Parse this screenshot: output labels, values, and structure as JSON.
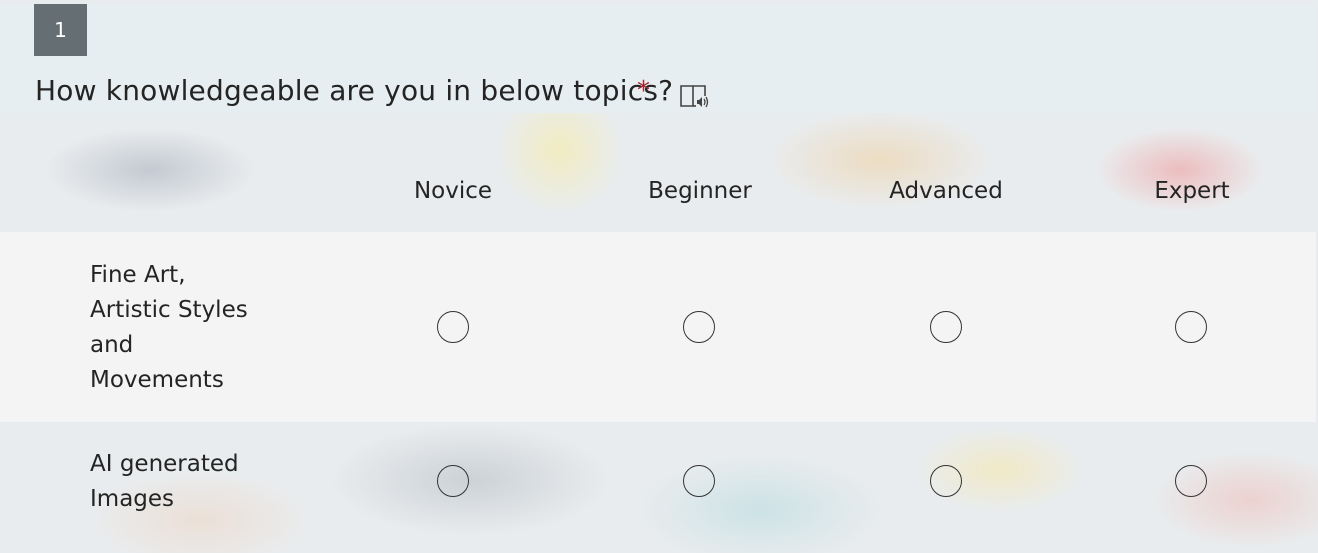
{
  "question": {
    "number": "1",
    "title": "How knowledgeable are you in below topics?",
    "required_mark": "*"
  },
  "icons": {
    "immersive_reader": "immersive-reader-icon"
  },
  "columns": [
    "Novice",
    "Beginner",
    "Advanced",
    "Expert"
  ],
  "rows": [
    {
      "label_lines": [
        "Fine Art,",
        "Artistic Styles",
        "and",
        "Movements"
      ]
    },
    {
      "label_lines": [
        "AI generated",
        "Images"
      ]
    }
  ],
  "colors": {
    "required": "#a4262c",
    "number_badge": "#656e72",
    "header_band": "#e7eef1",
    "row_band": "#f4f4f4"
  }
}
